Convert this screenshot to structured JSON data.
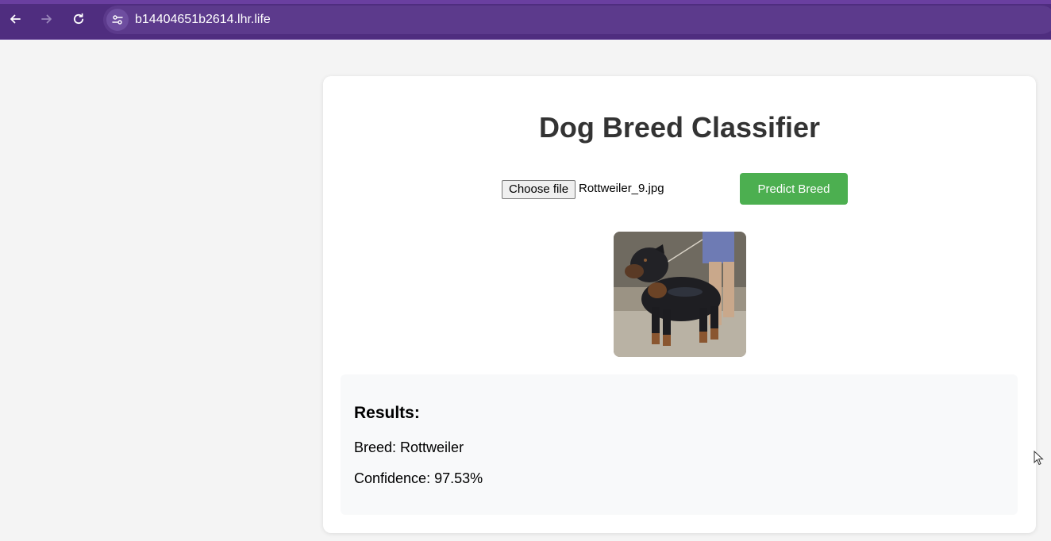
{
  "browser": {
    "url": "b14404651b2614.lhr.life",
    "icons": [
      "back-arrow-icon",
      "forward-arrow-icon",
      "reload-icon",
      "site-info-icon"
    ],
    "accent_color": "#4f2d7f"
  },
  "page": {
    "title": "Dog Breed Classifier",
    "upload": {
      "choose_label": "Choose file",
      "file_name": "Rottweiler_9.jpg"
    },
    "predict_label": "Predict Breed",
    "predict_color": "#4caf50",
    "preview_image": "rottweiler-dog-photo",
    "results": {
      "heading": "Results:",
      "breed_line": "Breed: Rottweiler",
      "confidence_line": "Confidence: 97.53%"
    }
  }
}
